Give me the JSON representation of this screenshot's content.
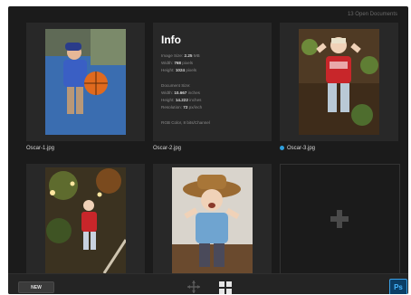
{
  "header": {
    "open_documents": "13 Open Documents"
  },
  "thumbnails": [
    {
      "caption": "Oscar-1.jpg"
    },
    {
      "caption": "Oscar-2.jpg"
    },
    {
      "caption": "Oscar-3.jpg",
      "status_dot_color": "#2f9fdc"
    }
  ],
  "info": {
    "title": "Info",
    "image_size_label": "Image Size:",
    "image_size_value": "2.25",
    "image_size_unit": "MB",
    "width_label": "Width:",
    "width_value": "768",
    "width_unit": "pixels",
    "height_label": "Height:",
    "height_value": "1024",
    "height_unit": "pixels",
    "doc_size_label": "Document Size:",
    "doc_width_label": "Width:",
    "doc_width_value": "10.667",
    "doc_width_unit": "inches",
    "doc_height_label": "Height:",
    "doc_height_value": "14.222",
    "doc_height_unit": "inches",
    "resolution_label": "Resolution:",
    "resolution_value": "72",
    "resolution_unit": "px/inch",
    "color_mode": "RGB Color, 8 bits/Channel"
  },
  "toolbar": {
    "new_label": "NEW",
    "move_icon": "move-icon",
    "grid_icon": "grid-view-icon",
    "app_icon_label": "Ps",
    "accent_color": "#2f9fdc"
  }
}
